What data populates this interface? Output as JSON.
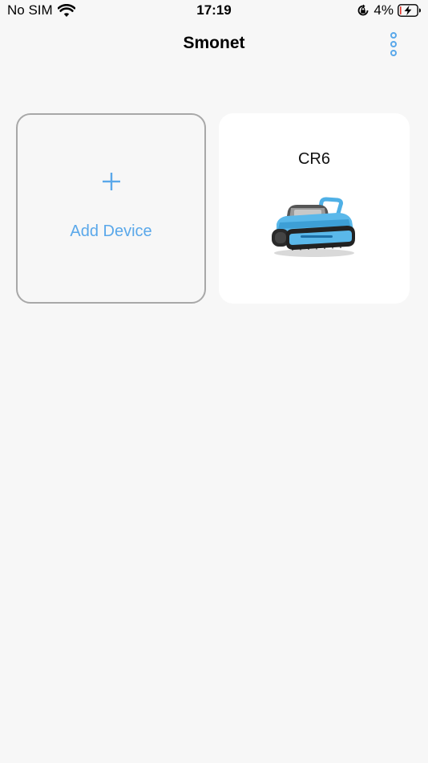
{
  "status_bar": {
    "carrier": "No SIM",
    "time": "17:19",
    "battery_percent": "4%",
    "icons": [
      "wifi-icon",
      "orientation-lock-icon",
      "battery-charging-icon"
    ]
  },
  "nav": {
    "title": "Smonet",
    "more_icon": "vertical-ellipsis-icon"
  },
  "devices": {
    "add_label": "Add Device",
    "add_icon": "plus-icon",
    "items": [
      {
        "name": "CR6",
        "image": "pool-robot-image"
      }
    ]
  },
  "colors": {
    "accent": "#5aa8ea",
    "background": "#f7f7f7",
    "card": "#ffffff",
    "border": "#a8a8a8"
  }
}
